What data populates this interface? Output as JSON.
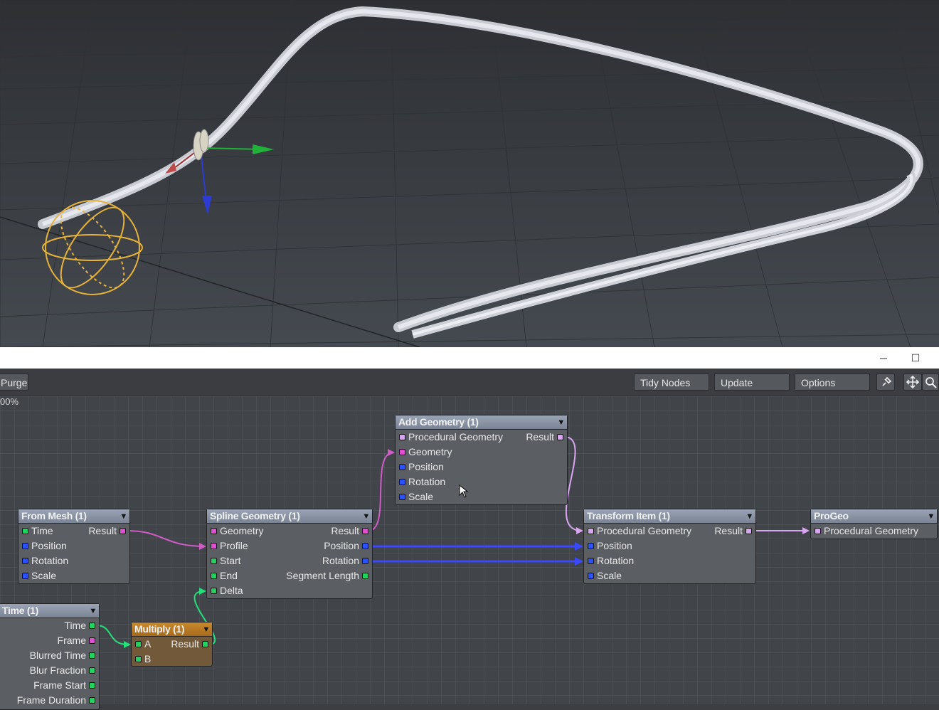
{
  "window_controls": {
    "minimize": "─",
    "maximize": "☐"
  },
  "toolbar": {
    "purge": "Purge",
    "tidy_nodes": "Tidy Nodes",
    "update": "Update",
    "options": "Options",
    "zoom": "00%"
  },
  "colors": {
    "green": "#23d15e",
    "blue": "#2a53ff",
    "magenta": "#e04fd0",
    "lilac": "#d9a6f2",
    "node_header": "#8a94a4",
    "multiply_header": "#b87a24"
  },
  "icons": [
    "pin-icon",
    "move-icon",
    "search-icon",
    "chevron-down-icon"
  ],
  "nodes": {
    "from_mesh": {
      "title": "From Mesh (1)",
      "inputs": [
        "Time",
        "Position",
        "Rotation",
        "Scale"
      ],
      "output": "Result"
    },
    "spline_geometry": {
      "title": "Spline Geometry (1)",
      "inputs": [
        "Geometry",
        "Profile",
        "Start",
        "End",
        "Delta"
      ],
      "outputs": [
        "Result",
        "Position",
        "Rotation",
        "Segment Length"
      ]
    },
    "add_geometry": {
      "title": "Add Geometry (1)",
      "inputs": [
        "Procedural Geometry",
        "Geometry",
        "Position",
        "Rotation",
        "Scale"
      ],
      "output": "Result"
    },
    "transform_item": {
      "title": "Transform Item (1)",
      "inputs": [
        "Procedural Geometry",
        "Position",
        "Rotation",
        "Scale"
      ],
      "output": "Result"
    },
    "progeo": {
      "title": "ProGeo",
      "inputs": [
        "Procedural Geometry"
      ]
    },
    "time": {
      "title": "Time (1)",
      "outputs": [
        "Time",
        "Frame",
        "Blurred Time",
        "Blur Fraction",
        "Frame Start",
        "Frame Duration"
      ]
    },
    "multiply": {
      "title": "Multiply (1)",
      "inputs": [
        "A",
        "B"
      ],
      "output": "Result"
    }
  }
}
